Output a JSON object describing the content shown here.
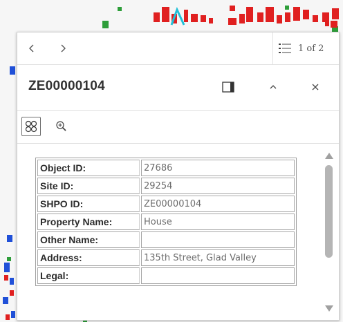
{
  "nav": {
    "prev_icon": "chevron-left-icon",
    "next_icon": "chevron-right-icon",
    "list_icon": "list-icon",
    "pager_text": "1 of 2"
  },
  "header": {
    "title": "ZE00000104",
    "dock_icon": "dock-icon",
    "collapse_icon": "chevron-up-icon",
    "close_icon": "close-icon"
  },
  "toolbar": {
    "select_icon": "select-feature-icon",
    "zoom_icon": "zoom-to-icon"
  },
  "attributes": [
    {
      "label": "Object ID:",
      "value": "27686"
    },
    {
      "label": "Site ID:",
      "value": "29254"
    },
    {
      "label": "SHPO ID:",
      "value": "ZE00000104"
    },
    {
      "label": "Property Name:",
      "value": "House"
    },
    {
      "label": "Other Name:",
      "value": ""
    },
    {
      "label": "Address:",
      "value": "135th Street, Glad Valley"
    },
    {
      "label": "Legal:",
      "value": ""
    }
  ],
  "colors": {
    "map_red": "#e02020",
    "map_blue": "#2050d8",
    "map_green": "#2e9e3a",
    "map_cyan": "#20c0d8"
  }
}
